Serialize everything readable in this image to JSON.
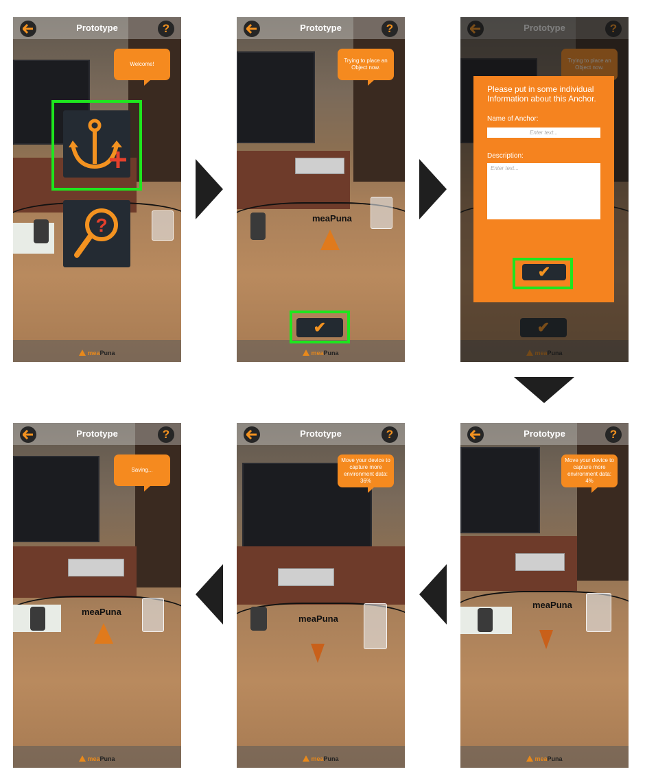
{
  "screens": [
    {
      "title": "Prototype",
      "bubble": "Welcome!",
      "brand_a": "mea",
      "brand_b": "Puna"
    },
    {
      "title": "Prototype",
      "bubble": "Trying to place an Object now.",
      "brand_a": "mea",
      "brand_b": "Puna",
      "model_logo": "meaPuna"
    },
    {
      "title": "Prototype",
      "bubble": "Trying to place an Object now.",
      "brand_a": "mea",
      "brand_b": "Puna",
      "dialog": {
        "heading": "Please put in some individual Information about this Anchor.",
        "name_label": "Name of Anchor:",
        "name_placeholder": "Enter text...",
        "desc_label": "Description:",
        "desc_placeholder": "Enter text..."
      }
    },
    {
      "title": "Prototype",
      "bubble": "Move your device to capture more environment data: 4%",
      "brand_a": "mea",
      "brand_b": "Puna",
      "model_logo": "meaPuna"
    },
    {
      "title": "Prototype",
      "bubble": "Move your device to capture more environment data: 36%",
      "brand_a": "mea",
      "brand_b": "Puna",
      "model_logo": "meaPuna"
    },
    {
      "title": "Prototype",
      "bubble": "Saving...",
      "brand_a": "mea",
      "brand_b": "Puna",
      "model_logo": "meaPuna"
    }
  ],
  "icons": {
    "back": "arrow-left-icon",
    "help": "question-mark-icon",
    "confirm": "checkmark-icon",
    "anchor": "anchor-add-icon",
    "search": "magnifier-question-icon"
  },
  "colors": {
    "accent": "#f58a1f",
    "dark": "#242b33",
    "highlight": "#1ee61e"
  }
}
